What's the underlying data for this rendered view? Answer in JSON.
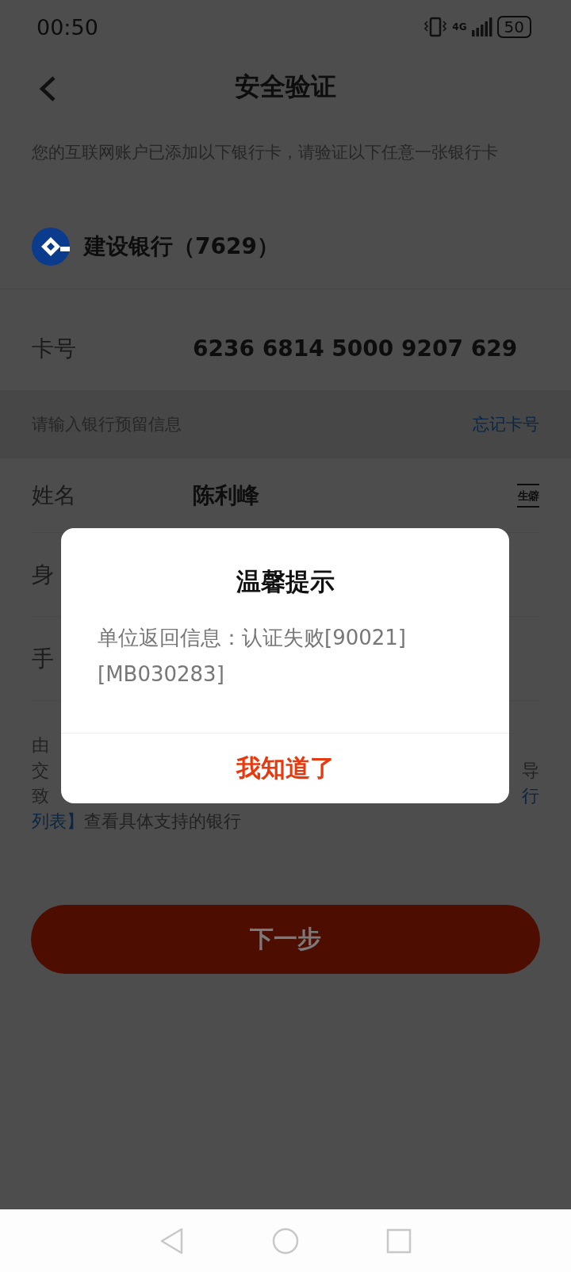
{
  "status_bar": {
    "time": "00:50",
    "network": "4G",
    "battery": "50"
  },
  "header": {
    "title": "安全验证"
  },
  "intro": "您的互联网账户已添加以下银行卡，请验证以下任意一张银行卡",
  "bank": {
    "name": "建设银行（7629）"
  },
  "card_number": {
    "label": "卡号",
    "value": "6236 6814 5000 9207 629"
  },
  "section": {
    "label": "请输入银行预留信息",
    "link": "忘记卡号"
  },
  "fields": [
    {
      "kind": "name",
      "label": "姓名",
      "value": "陈利峰",
      "icon_text": "生僻"
    },
    {
      "kind": "plain",
      "label": "身"
    },
    {
      "kind": "plain",
      "label": "手"
    }
  ],
  "notice_lines": [
    {
      "kind": "split",
      "segments": [
        {
          "text": "由",
          "link": false
        }
      ]
    },
    {
      "kind": "split",
      "segments": [
        {
          "text": "交",
          "link": false
        },
        {
          "text": "导",
          "link": false
        }
      ]
    },
    {
      "kind": "split",
      "segments": [
        {
          "text": "致",
          "link": false
        },
        {
          "text": "行",
          "link": true
        }
      ]
    },
    {
      "kind": "run",
      "segments": [
        {
          "text": "列表】",
          "link": true
        },
        {
          "text": "查看具体支持的银行",
          "link": false
        }
      ]
    }
  ],
  "next_button": {
    "label": "下一步"
  },
  "dialog": {
    "title": "温馨提示",
    "message": "单位返回信息：认证失败[90021][MB030283]",
    "button": "我知道了"
  }
}
